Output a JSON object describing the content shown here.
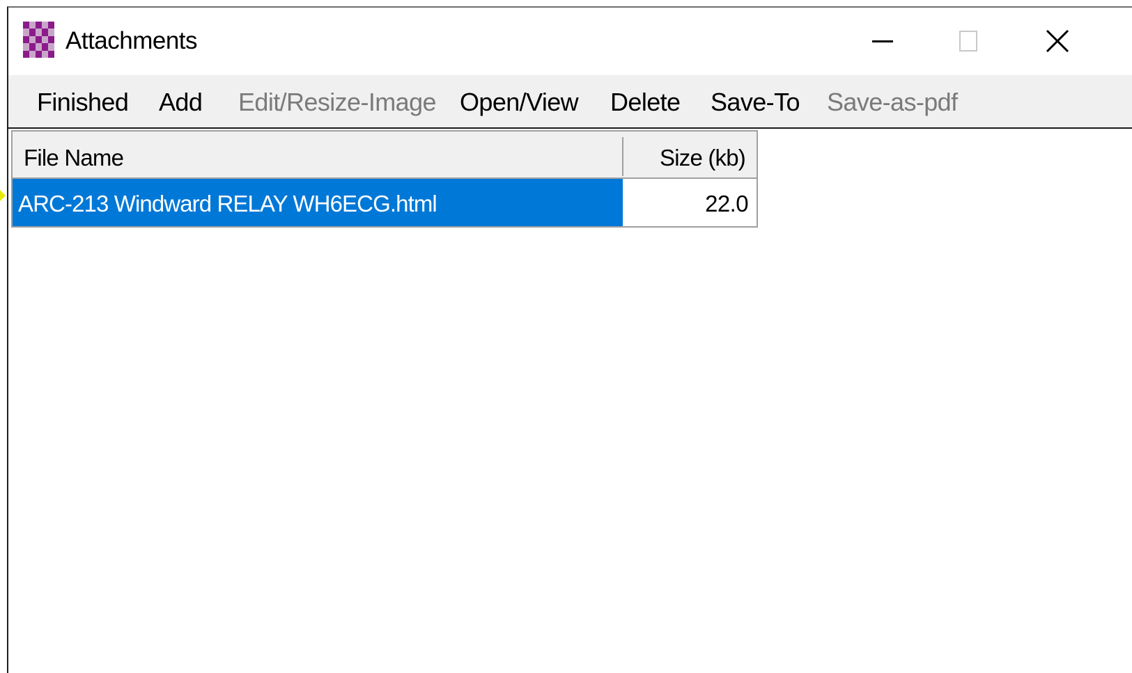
{
  "window": {
    "title": "Attachments",
    "icon": "checkerboard-app-icon",
    "controls": {
      "minimize": "minimize-icon",
      "maximize": "maximize-icon",
      "close": "close-icon"
    }
  },
  "toolbar": {
    "items": [
      {
        "label": "Finished",
        "enabled": true
      },
      {
        "label": "Add",
        "enabled": true
      },
      {
        "label": "Edit/Resize-Image",
        "enabled": false
      },
      {
        "label": "Open/View",
        "enabled": true
      },
      {
        "label": "Delete",
        "enabled": true
      },
      {
        "label": "Save-To",
        "enabled": true
      },
      {
        "label": "Save-as-pdf",
        "enabled": false
      }
    ]
  },
  "table": {
    "columns": [
      "File Name",
      "Size (kb)"
    ],
    "rows": [
      {
        "file_name": "ARC-213 Windward RELAY WH6ECG.html",
        "size_kb": "22.0",
        "selected": true
      }
    ]
  },
  "colors": {
    "selection": "#0078d7",
    "header_bg": "#f0f0f0",
    "disabled_text": "#7a7a7a",
    "icon_primary": "#8b1a8b",
    "icon_secondary": "#c9a6c9"
  }
}
